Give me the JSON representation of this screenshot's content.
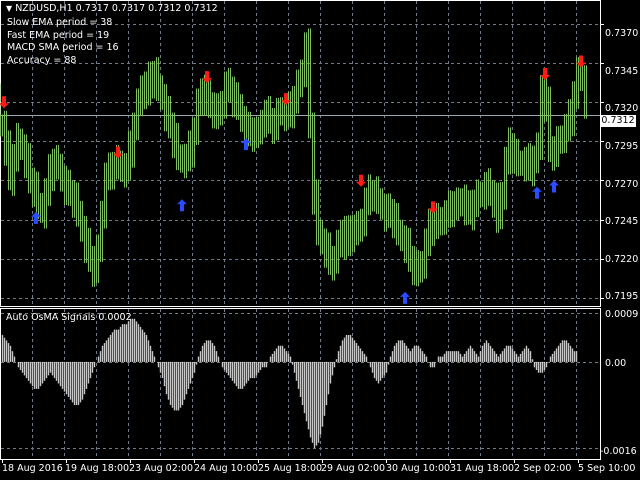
{
  "header": {
    "symbol_line": "NZDUSD,H1  0.7317 0.7317 0.7312 0.7312",
    "params": [
      "Slow EMA period = 38",
      "Fast EMA period = 19",
      "MACD SMA period = 16",
      "Accuracy = 88"
    ]
  },
  "current_price": "0.7312",
  "main_axis": {
    "ticks": [
      "0.7370",
      "0.7345",
      "0.7320",
      "0.7295",
      "0.7270",
      "0.7245",
      "0.7220",
      "0.7195"
    ],
    "values": [
      0.737,
      0.7345,
      0.732,
      0.7295,
      0.727,
      0.7245,
      0.722,
      0.7195
    ]
  },
  "indicator": {
    "title": "Auto OsMA Signals 0.0002",
    "ticks": [
      "0.0009",
      "0.00",
      "-0.0016"
    ],
    "values": [
      0.0009,
      0.0,
      -0.0016
    ]
  },
  "time_axis": {
    "labels": [
      "18 Aug 2016",
      "19 Aug 18:00",
      "23 Aug 02:00",
      "24 Aug 10:00",
      "25 Aug 18:00",
      "29 Aug 02:00",
      "30 Aug 10:00",
      "31 Aug 18:00",
      "2 Sep 02:00",
      "5 Sep 10:00"
    ]
  },
  "colors": {
    "background": "#000000",
    "candle": "#7fbf5f",
    "grid": "#6e7a88",
    "sell_arrow": "#ff1a1a",
    "buy_arrow": "#2a4dff",
    "histogram": "#c8c8c8"
  },
  "chart_data": [
    {
      "type": "line",
      "title": "NZDUSD,H1",
      "ylim": [
        0.719,
        0.7385
      ],
      "x": [
        0,
        4,
        8,
        12,
        16,
        20,
        24,
        28,
        32,
        36,
        40,
        44,
        48,
        52,
        56,
        60,
        64,
        68,
        72,
        76,
        80,
        84,
        88,
        92,
        96,
        100,
        104,
        108,
        112,
        116,
        120,
        124,
        128,
        132,
        136,
        140,
        144,
        148,
        152,
        156,
        160,
        164,
        168,
        172,
        176,
        180,
        184,
        188,
        192,
        196,
        200,
        204,
        208,
        212,
        216,
        220,
        224,
        228,
        232,
        236,
        240,
        244,
        248,
        252,
        256,
        260,
        264,
        268,
        272,
        276,
        280,
        284,
        288,
        292,
        296,
        300,
        304,
        308,
        312,
        316,
        320,
        324,
        328,
        332,
        336,
        340,
        344,
        348,
        352,
        356,
        360,
        364,
        368,
        372,
        376,
        380,
        384,
        388,
        392,
        396,
        400,
        404,
        408,
        412,
        416,
        420,
        424,
        428,
        432,
        436,
        440,
        444,
        448,
        452,
        456,
        460,
        464,
        468,
        472,
        476,
        480,
        484,
        488,
        492,
        496,
        500,
        504,
        508,
        512,
        516,
        520,
        524,
        528,
        532,
        536,
        540,
        544,
        548,
        552,
        556,
        560,
        564,
        568,
        572,
        576,
        580,
        584
      ],
      "series": [
        {
          "values": [
            0.7305,
            0.729,
            0.7272,
            0.7285,
            0.7296,
            0.729,
            0.7282,
            0.727,
            0.7265,
            0.7255,
            0.725,
            0.7262,
            0.7275,
            0.7282,
            0.728,
            0.727,
            0.7265,
            0.7262,
            0.7258,
            0.725,
            0.7238,
            0.7228,
            0.722,
            0.7214,
            0.7225,
            0.725,
            0.7272,
            0.7276,
            0.728,
            0.7282,
            0.7276,
            0.7278,
            0.729,
            0.7305,
            0.7318,
            0.733,
            0.7326,
            0.7334,
            0.7338,
            0.733,
            0.7322,
            0.7312,
            0.7305,
            0.7296,
            0.7286,
            0.7282,
            0.7284,
            0.729,
            0.7302,
            0.7318,
            0.7328,
            0.7322,
            0.7318,
            0.7315,
            0.7312,
            0.732,
            0.733,
            0.7328,
            0.7322,
            0.7318,
            0.7308,
            0.73,
            0.7302,
            0.73,
            0.73,
            0.7308,
            0.7312,
            0.7308,
            0.7305,
            0.7312,
            0.7316,
            0.7312,
            0.7315,
            0.7322,
            0.733,
            0.734,
            0.7355,
            0.7305,
            0.726,
            0.7238,
            0.723,
            0.7225,
            0.7218,
            0.722,
            0.7228,
            0.7238,
            0.723,
            0.7236,
            0.724,
            0.7238,
            0.7245,
            0.7256,
            0.7262,
            0.7262,
            0.7258,
            0.7252,
            0.7248,
            0.725,
            0.7245,
            0.7238,
            0.7232,
            0.7228,
            0.722,
            0.7215,
            0.7212,
            0.7218,
            0.723,
            0.724,
            0.7245,
            0.7242,
            0.7246,
            0.7248,
            0.7252,
            0.7255,
            0.7254,
            0.7258,
            0.7252,
            0.725,
            0.7256,
            0.726,
            0.7262,
            0.7266,
            0.7262,
            0.7258,
            0.7246,
            0.7262,
            0.7282,
            0.7292,
            0.7286,
            0.7282,
            0.728,
            0.7282,
            0.7278,
            0.7284,
            0.729,
            0.733,
            0.7318,
            0.729,
            0.7288,
            0.7294,
            0.7298,
            0.7303,
            0.731,
            0.7325,
            0.7338,
            0.7334,
            0.732,
            0.7312
          ]
        }
      ],
      "sell_signals": [
        {
          "x": 4,
          "y": 0.7316
        },
        {
          "x": 118,
          "y": 0.7284
        },
        {
          "x": 207,
          "y": 0.7332
        },
        {
          "x": 286,
          "y": 0.7318
        },
        {
          "x": 361,
          "y": 0.7266
        },
        {
          "x": 433,
          "y": 0.7249
        },
        {
          "x": 545,
          "y": 0.7334
        },
        {
          "x": 581,
          "y": 0.7342
        }
      ],
      "buy_signals": [
        {
          "x": 36,
          "y": 0.725
        },
        {
          "x": 182,
          "y": 0.7258
        },
        {
          "x": 246,
          "y": 0.7297
        },
        {
          "x": 405,
          "y": 0.7199
        },
        {
          "x": 537,
          "y": 0.7266
        },
        {
          "x": 554,
          "y": 0.727
        }
      ]
    },
    {
      "type": "bar",
      "title": "Auto OsMA Signals 0.0002",
      "ylim": [
        -0.0018,
        0.001
      ],
      "x_start": 2,
      "x_step": 4,
      "values": [
        0.0005,
        0.0004,
        0.0003,
        0.0001,
        -0.0001,
        -0.0002,
        -0.0003,
        -0.0004,
        -0.0005,
        -0.0005,
        -0.0004,
        -0.0003,
        -0.0002,
        -0.0003,
        -0.0004,
        -0.0005,
        -0.0006,
        -0.0007,
        -0.0008,
        -0.0008,
        -0.0007,
        -0.0005,
        -0.0003,
        -0.0001,
        0.0001,
        0.0003,
        0.0004,
        0.0005,
        0.0006,
        0.0006,
        0.0007,
        0.0007,
        0.0008,
        0.0008,
        0.0007,
        0.0006,
        0.0005,
        0.0003,
        0.0001,
        -0.0001,
        -0.0003,
        -0.0006,
        -0.0008,
        -0.0009,
        -0.0009,
        -0.0008,
        -0.0006,
        -0.0004,
        -0.0002,
        0.0001,
        0.0003,
        0.0004,
        0.0004,
        0.0003,
        0.0001,
        -0.0001,
        -0.0002,
        -0.0003,
        -0.0004,
        -0.0005,
        -0.0005,
        -0.0004,
        -0.0003,
        -0.0003,
        -0.0002,
        -0.0001,
        -0.0001,
        0.0001,
        0.0002,
        0.0003,
        0.0003,
        0.0002,
        0.0001,
        -0.0002,
        -0.0005,
        -0.0008,
        -0.0011,
        -0.0014,
        -0.0016,
        -0.0015,
        -0.0012,
        -0.0008,
        -0.0004,
        -0.0001,
        0.0002,
        0.0004,
        0.0005,
        0.0005,
        0.0004,
        0.0003,
        0.0002,
        0.0001,
        -0.0001,
        -0.0003,
        -0.0004,
        -0.0003,
        -0.0002,
        0.0001,
        0.0003,
        0.0004,
        0.0004,
        0.0003,
        0.0002,
        0.0003,
        0.0003,
        0.0002,
        0.0001,
        -0.0001,
        -0.0001,
        0.0001,
        0.0001,
        0.0002,
        0.0002,
        0.0002,
        0.0002,
        0.0001,
        0.0002,
        0.0003,
        0.0002,
        0.0001,
        0.0003,
        0.0004,
        0.0003,
        0.0002,
        0.0001,
        0.0002,
        0.0003,
        0.0003,
        0.0002,
        0.0001,
        0.0002,
        0.0003,
        0.0002,
        -0.0001,
        -0.0002,
        -0.0002,
        -0.0001,
        0.0001,
        0.0002,
        0.0003,
        0.0004,
        0.0004,
        0.0003,
        0.0002
      ]
    }
  ]
}
